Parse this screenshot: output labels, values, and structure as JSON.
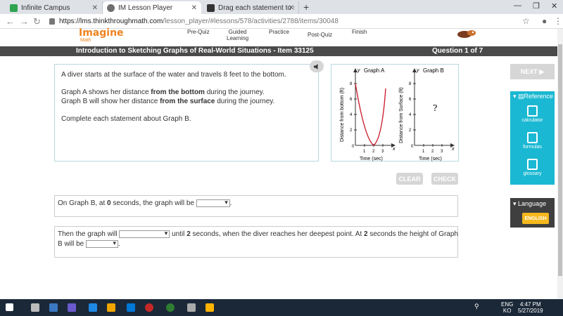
{
  "browser": {
    "tabs": [
      {
        "label": "Infinite Campus",
        "color": "#2ea44f",
        "active": false
      },
      {
        "label": "IM Lesson Player",
        "color": "#6e6e6e",
        "active": true
      },
      {
        "label": "Drag each statement to show wh",
        "color": "#333333",
        "active": false
      }
    ],
    "new_tab": "+",
    "window_controls": [
      "—",
      "❐",
      "✕"
    ],
    "url_host": "https://lms.thinkthroughmath.com",
    "url_path": "/lesson_player/#lessons/578/activities/2788/items/30048"
  },
  "header": {
    "logo": "Imagine",
    "logo_sub": "Math",
    "nav": [
      "Pre-Quiz",
      "Guided\nLearning",
      "Practice",
      "Post-Quiz",
      "Finish"
    ]
  },
  "titlebar": {
    "title": "Introduction to Sketching Graphs of Real-World Situations - Item 33125",
    "question": "Question 1 of 7"
  },
  "prompt": {
    "line1": "A diver starts at the surface of the water and travels 8 feet to the bottom.",
    "line2_pre": "Graph A shows her distance ",
    "line2_bold": "from the bottom",
    "line2_post": " during the journey.",
    "line3_pre": "Graph B will show her distance ",
    "line3_bold": "from the surface",
    "line3_post": " during the journey.",
    "line4": "Complete each statement about Graph B."
  },
  "graphs": {
    "graph_a": {
      "title": "Graph A",
      "ylabel": "Distance from bottom (ft)",
      "xlabel": "Time (sec)"
    },
    "graph_b": {
      "title": "Graph B",
      "ylabel": "Distance from Surface (ft)",
      "xlabel": "Time (sec)",
      "placeholder": "?"
    },
    "y_axis_letter": "y",
    "x_axis_letter": "x",
    "y_ticks": [
      "8",
      "6",
      "4",
      "2"
    ],
    "x_ticks": [
      "1",
      "2",
      "3"
    ],
    "origin": "0",
    "curve_color": "#cc2233"
  },
  "buttons": {
    "clear": "CLEAR",
    "check": "CHECK",
    "next": "NEXT ▶"
  },
  "question1": {
    "pre": "On Graph B, at ",
    "num": "0",
    "post": " seconds, the graph will be",
    "tail": "."
  },
  "question2": {
    "pre": "Then the graph will",
    "mid1": "until ",
    "num1": "2",
    "mid2": " seconds, when the diver reaches her deepest point. At ",
    "num2": "2",
    "mid3": " seconds the height of Graph",
    "line2": "B will be",
    "tail": "."
  },
  "sidebar": {
    "reference": "Reference",
    "tools": [
      "calculator",
      "formulas",
      "glossary"
    ],
    "language": "Language",
    "english": "ENGLISH"
  },
  "taskbar": {
    "lang1": "ENG",
    "lang2": "KO",
    "time": "4:47 PM",
    "date": "5/27/2019"
  }
}
